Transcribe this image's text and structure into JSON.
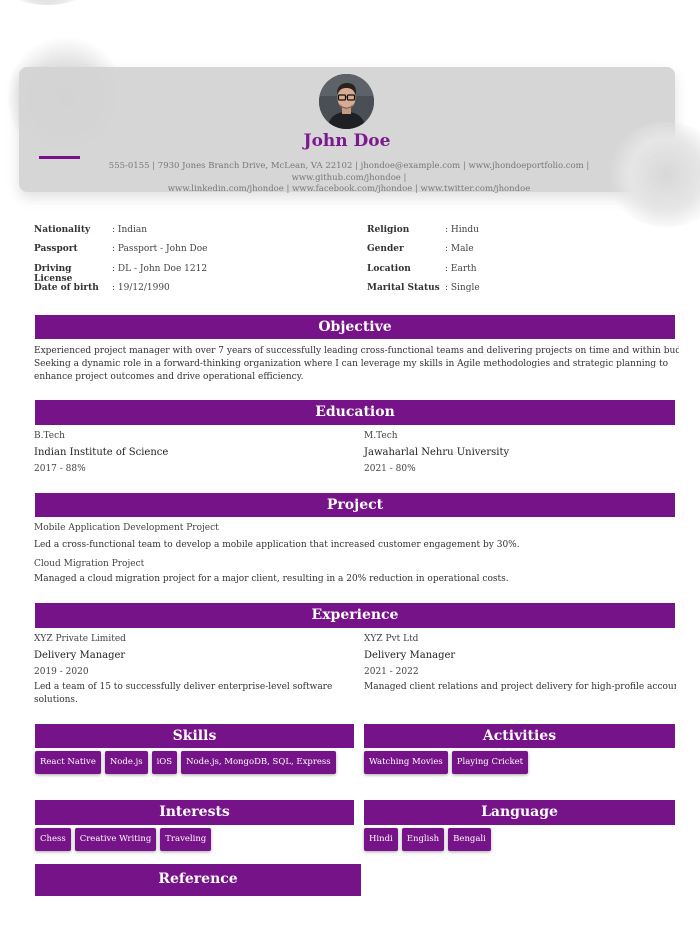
{
  "profile": {
    "name": "John Doe",
    "contact_line1": "555-0155 | 7930 Jones Branch Drive, McLean, VA 22102 | jhondoe@example.com | www.jhondoeportfolio.com | www.github.com/jhondoe |",
    "contact_line2": "www.linkedin.com/jhondoe | www.facebook.com/jhondoe | www.twitter.com/jhondoe"
  },
  "personal_left": [
    {
      "label": "Nationality",
      "value": ": Indian"
    },
    {
      "label": "Passport",
      "value": ": Passport - John Doe"
    },
    {
      "label": "Driving License",
      "value": ": DL - John Doe 1212"
    },
    {
      "label": "Date of birth",
      "value": ": 19/12/1990"
    }
  ],
  "personal_right": [
    {
      "label": "Religion",
      "value": ": Hindu"
    },
    {
      "label": "Gender",
      "value": ": Male"
    },
    {
      "label": "Location",
      "value": ": Earth"
    },
    {
      "label": "Marital Status",
      "value": ": Single"
    }
  ],
  "objective": {
    "title": "Objective",
    "lines": [
      "Experienced project manager with over 7 years of successfully leading cross-functional teams and delivering projects on time and within budget.",
      "Seeking a dynamic role in a forward-thinking organization where I can leverage my skills in Agile methodologies and strategic planning to",
      "enhance project outcomes and drive operational efficiency."
    ]
  },
  "education": {
    "title": "Education",
    "items": [
      {
        "degree": "B.Tech",
        "school": "Indian Institute of Science",
        "detail": "2017 - 88%"
      },
      {
        "degree": "M.Tech",
        "school": "Jawaharlal Nehru University",
        "detail": "2021 - 80%"
      }
    ]
  },
  "project": {
    "title": "Project",
    "items": [
      {
        "name": "Mobile Application Development Project",
        "desc": "Led a cross-functional team to develop a mobile application that increased customer engagement by 30%."
      },
      {
        "name": "Cloud Migration Project",
        "desc": "Managed a cloud migration project for a major client, resulting in a 20% reduction in operational costs."
      }
    ]
  },
  "experience": {
    "title": "Experience",
    "items": [
      {
        "company": "XYZ Private Limited",
        "role": "Delivery Manager",
        "period": "2019 - 2020",
        "desc1": "Led a team of 15 to successfully deliver enterprise-level software",
        "desc2": "solutions."
      },
      {
        "company": "XYZ Pvt Ltd",
        "role": "Delivery Manager",
        "period": "2021 - 2022",
        "desc1": "Managed client relations and project delivery for high-profile accounts.",
        "desc2": ""
      }
    ]
  },
  "skills": {
    "title": "Skills",
    "items": [
      "React Native",
      "Node.js",
      "iOS",
      "Node.js, MongoDB, SQL, Express"
    ]
  },
  "activities": {
    "title": "Activities",
    "items": [
      "Watching Movies",
      "Playing Cricket"
    ]
  },
  "interests": {
    "title": "Interests",
    "items": [
      "Chess",
      "Creative Writing",
      "Traveling"
    ]
  },
  "language": {
    "title": "Language",
    "items": [
      "Hindi",
      "English",
      "Bengali"
    ]
  },
  "reference": {
    "title": "Reference"
  },
  "colors": {
    "accent": "#761388",
    "name": "#7b1a8e",
    "header_bg": "#d2d2d2"
  }
}
